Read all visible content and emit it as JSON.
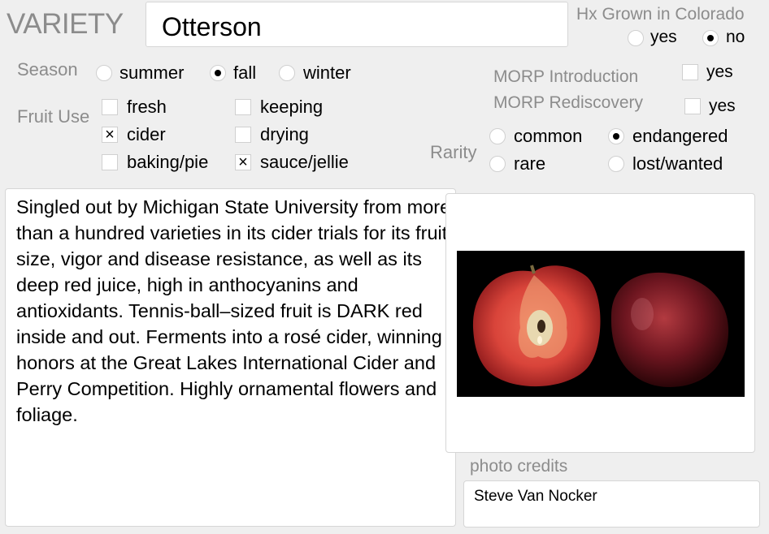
{
  "variety": {
    "label": "VARIETY",
    "value": "Otterson"
  },
  "hx_grown": {
    "label": "Hx Grown in Colorado",
    "options": [
      {
        "label": "yes",
        "selected": false
      },
      {
        "label": "no",
        "selected": true
      }
    ]
  },
  "season": {
    "label": "Season",
    "options": [
      {
        "label": "summer",
        "selected": false
      },
      {
        "label": "fall",
        "selected": true
      },
      {
        "label": "winter",
        "selected": false
      }
    ]
  },
  "fruit_use": {
    "label": "Fruit Use",
    "options": [
      {
        "label": "fresh",
        "checked": false
      },
      {
        "label": "keeping",
        "checked": false
      },
      {
        "label": "cider",
        "checked": true
      },
      {
        "label": "drying",
        "checked": false
      },
      {
        "label": "baking/pie",
        "checked": false
      },
      {
        "label": "sauce/jellie",
        "checked": true
      }
    ]
  },
  "check_mark": "×",
  "morp": {
    "introduction": {
      "label": "MORP Introduction",
      "option": "yes",
      "checked": false
    },
    "rediscovery": {
      "label": "MORP Rediscovery",
      "option": "yes",
      "checked": false
    }
  },
  "rarity": {
    "label": "Rarity",
    "options": [
      {
        "label": "common",
        "selected": false
      },
      {
        "label": "endangered",
        "selected": true
      },
      {
        "label": "rare",
        "selected": false
      },
      {
        "label": "lost/wanted",
        "selected": false
      }
    ]
  },
  "description": "Singled out by Michigan State University from more than a hundred varieties in its cider trials for its fruit size, vigor and disease resistance, as well as its deep red juice, high in anthocyanins and antioxidants. Tennis-ball–sized fruit is DARK red inside and out. Ferments into a rosé cider, winning honors at the Great Lakes International Cider and Perry Competition. Highly ornamental flowers and foliage.",
  "photo": {
    "subject": "halved-apple-and-whole-apple"
  },
  "photo_credits": {
    "label": "photo credits",
    "value": "Steve Van Nocker"
  }
}
